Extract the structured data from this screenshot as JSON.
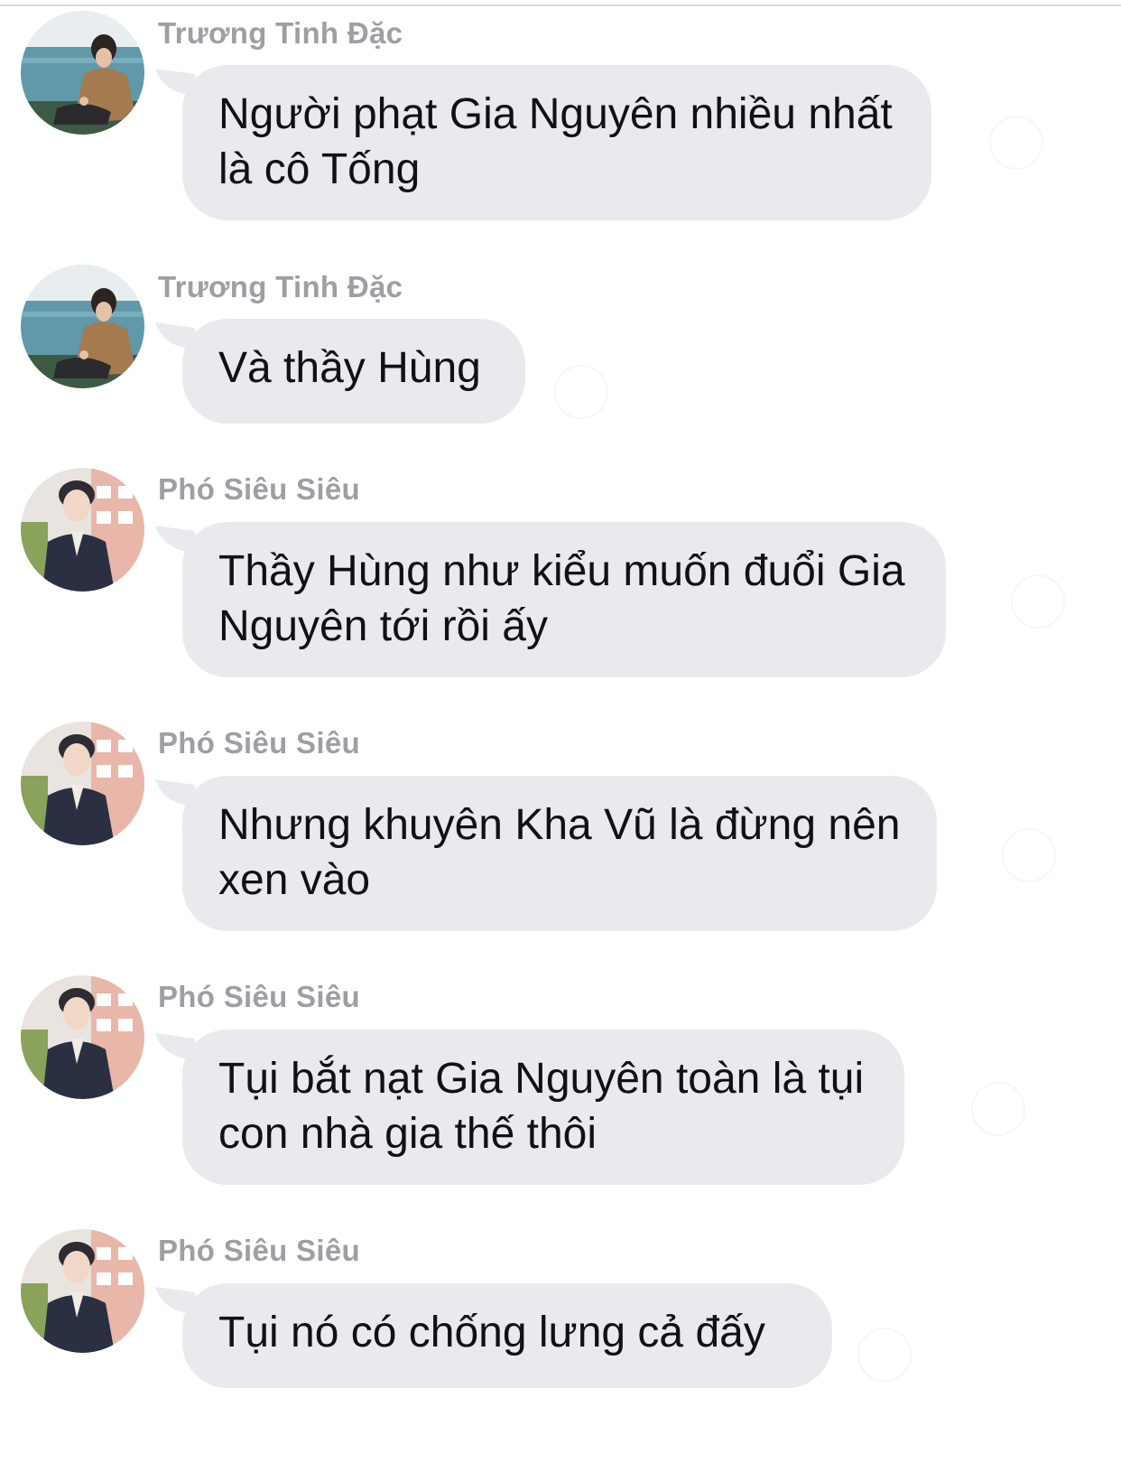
{
  "messages": [
    {
      "sender": "Trương Tinh Đặc",
      "line1": "Người phạt Gia Nguyên nhiều nhất",
      "line2": "là cô Tống"
    },
    {
      "sender": "Trương Tinh Đặc",
      "line1": "Và thầy Hùng",
      "line2": ""
    },
    {
      "sender": "Phó Siêu Siêu",
      "line1": "Thầy Hùng như kiểu muốn đuổi Gia",
      "line2": "Nguyên tới rồi ấy"
    },
    {
      "sender": "Phó Siêu Siêu",
      "line1": "Nhưng khuyên Kha Vũ là đừng nên",
      "line2": "xen vào"
    },
    {
      "sender": "Phó Siêu Siêu",
      "line1": "Tụi bắt nạt Gia Nguyên toàn là tụi",
      "line2": "con nhà gia thế thôi"
    },
    {
      "sender": "Phó Siêu Siêu",
      "line1": "Tụi nó có chống lưng cả đấy",
      "line2": ""
    }
  ],
  "colors": {
    "bubble": "#e9eaed",
    "sender_text": "#9c9fa4",
    "message_text": "#101113"
  }
}
